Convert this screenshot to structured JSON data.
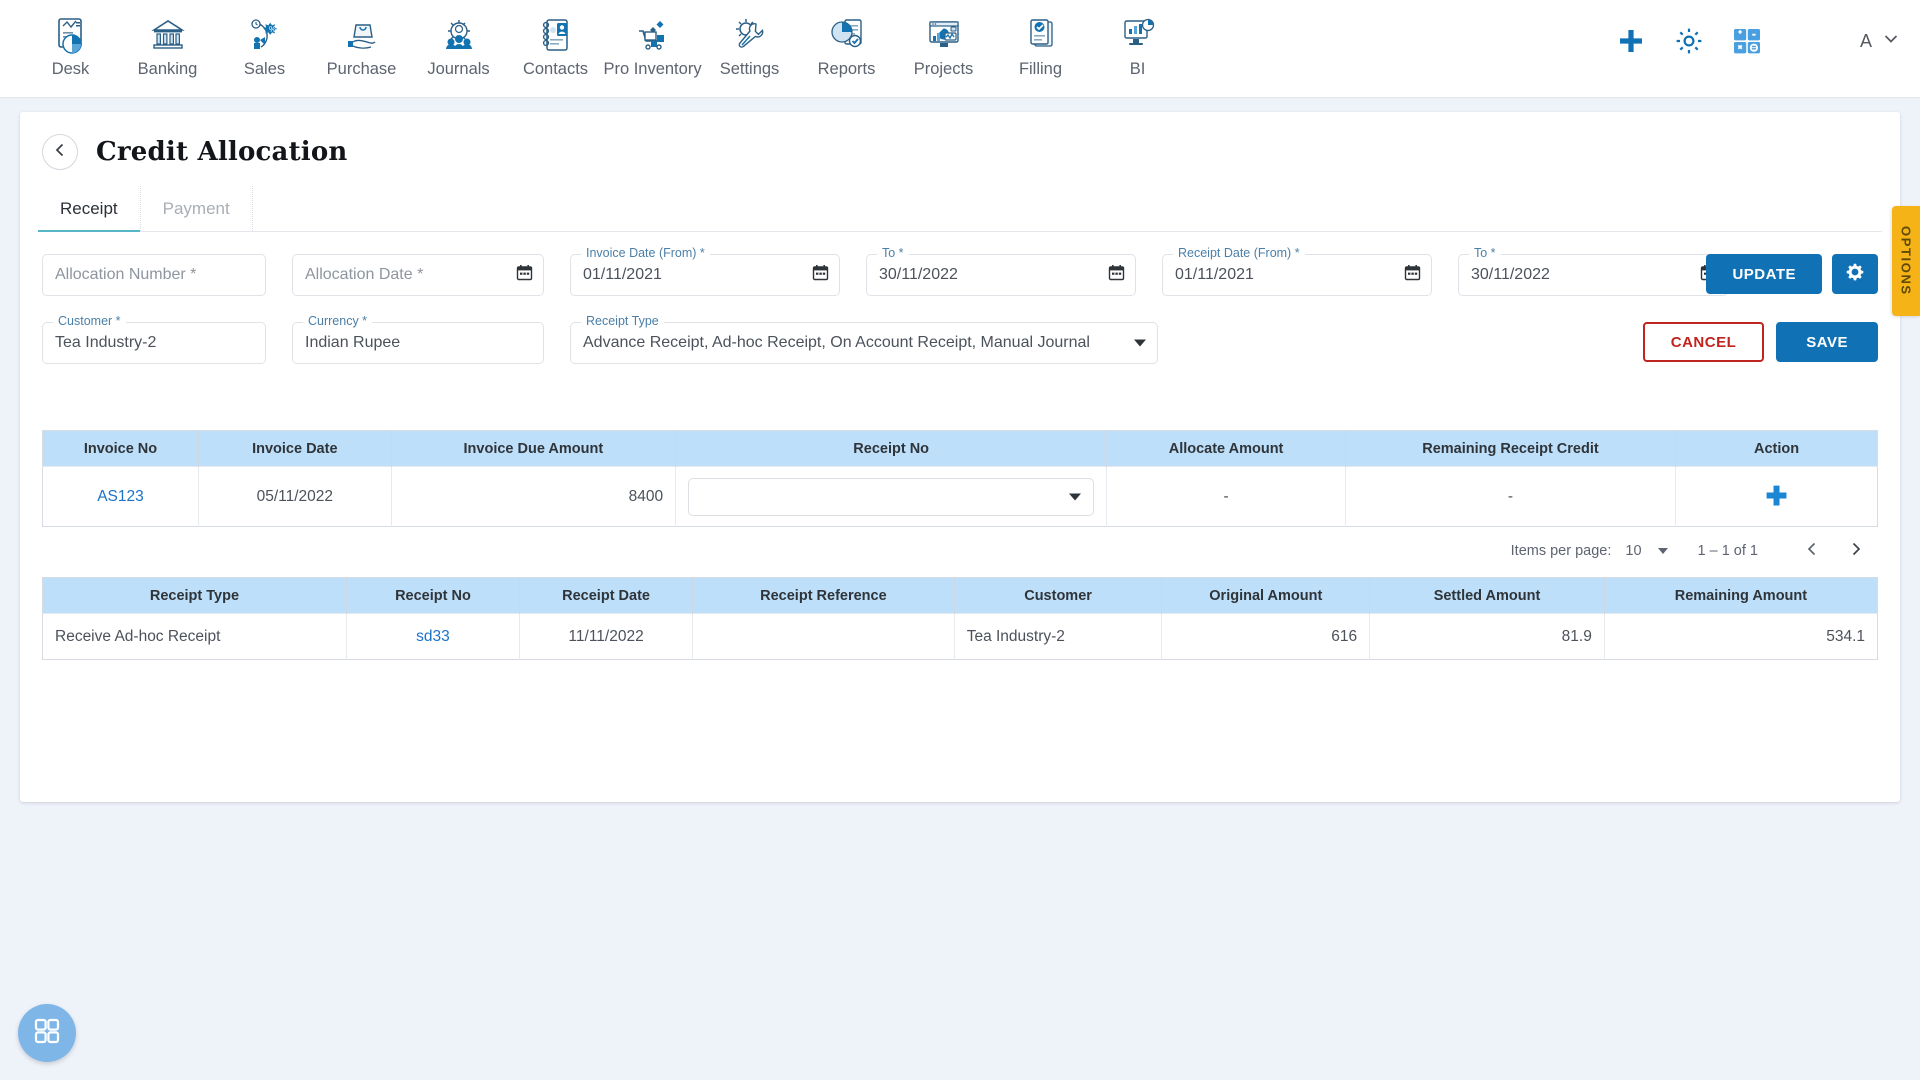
{
  "nav": {
    "items": [
      {
        "label": "Desk",
        "icon": "dashboard-icon"
      },
      {
        "label": "Banking",
        "icon": "bank-icon"
      },
      {
        "label": "Sales",
        "icon": "sales-icon"
      },
      {
        "label": "Purchase",
        "icon": "purchase-icon"
      },
      {
        "label": "Journals",
        "icon": "journals-icon"
      },
      {
        "label": "Contacts",
        "icon": "contacts-icon"
      },
      {
        "label": "Pro Inventory",
        "icon": "inventory-icon"
      },
      {
        "label": "Settings",
        "icon": "settings-icon"
      },
      {
        "label": "Reports",
        "icon": "reports-icon"
      },
      {
        "label": "Projects",
        "icon": "projects-icon"
      },
      {
        "label": "Filling",
        "icon": "filling-icon"
      },
      {
        "label": "BI",
        "icon": "bi-icon"
      }
    ],
    "right": {
      "add_icon": "plus-icon",
      "settings_icon": "gear-icon",
      "calculator_icon": "calculator-icon",
      "user_initial": "A",
      "chevron_icon": "chevron-down-icon"
    }
  },
  "header": {
    "back_icon": "chevron-left-icon",
    "title": "Credit Allocation"
  },
  "tabs": [
    {
      "label": "Receipt",
      "active": true
    },
    {
      "label": "Payment",
      "active": false
    }
  ],
  "form": {
    "allocation_number": {
      "label": "Allocation Number *",
      "placeholder": "Allocation Number *",
      "value": ""
    },
    "allocation_date": {
      "label": "Allocation Date *",
      "placeholder": "Allocation Date *",
      "value": "",
      "icon": "calendar-icon"
    },
    "invoice_date_from": {
      "label": "Invoice Date (From) *",
      "value": "01/11/2021",
      "icon": "calendar-icon"
    },
    "invoice_date_to": {
      "label": "To *",
      "value": "30/11/2022",
      "icon": "calendar-icon"
    },
    "receipt_date_from": {
      "label": "Receipt Date (From) *",
      "value": "01/11/2021",
      "icon": "calendar-icon"
    },
    "receipt_date_to": {
      "label": "To *",
      "value": "30/11/2022",
      "icon": "calendar-icon"
    },
    "customer": {
      "label": "Customer *",
      "value": "Tea Industry-2"
    },
    "currency": {
      "label": "Currency *",
      "value": "Indian Rupee"
    },
    "receipt_type": {
      "label": "Receipt Type",
      "value": "Advance Receipt, Ad-hoc Receipt, On Account Receipt, Manual Journal",
      "icon": "chevron-down-icon"
    }
  },
  "buttons": {
    "update": "UPDATE",
    "settings_icon": "gear-icon",
    "cancel": "CANCEL",
    "save": "SAVE"
  },
  "invoice_table": {
    "columns": [
      "Invoice No",
      "Invoice Date",
      "Invoice Due Amount",
      "Receipt No",
      "Allocate Amount",
      "Remaining Receipt Credit",
      "Action"
    ],
    "rows": [
      {
        "invoice_no": "AS123",
        "invoice_date": "05/11/2022",
        "invoice_due_amount": "8400",
        "receipt_no": "",
        "allocate_amount": "-",
        "remaining_receipt_credit": "-",
        "action_icon": "plus-icon"
      }
    ]
  },
  "paginator": {
    "items_per_page_label": "Items per page:",
    "items_per_page_value": "10",
    "range": "1 – 1 of 1",
    "prev_icon": "chevron-left-icon",
    "next_icon": "chevron-right-icon"
  },
  "receipt_table": {
    "columns": [
      "Receipt Type",
      "Receipt No",
      "Receipt Date",
      "Receipt Reference",
      "Customer",
      "Original Amount",
      "Settled Amount",
      "Remaining Amount"
    ],
    "rows": [
      {
        "receipt_type": "Receive Ad-hoc Receipt",
        "receipt_no": "sd33",
        "receipt_date": "11/11/2022",
        "receipt_reference": "",
        "customer": "Tea Industry-2",
        "original_amount": "616",
        "settled_amount": "81.9",
        "remaining_amount": "534.1"
      }
    ]
  },
  "options_tab": {
    "label": "OPTIONS"
  },
  "fab": {
    "icon": "grid-apps-icon"
  },
  "colors": {
    "primary": "#1072b5",
    "danger": "#c0241f",
    "table_header": "#bddffa",
    "link": "#1a73c7",
    "options": "#f5b318",
    "fab": "#7fb6e8",
    "tab_underline": "#57b7c9"
  }
}
